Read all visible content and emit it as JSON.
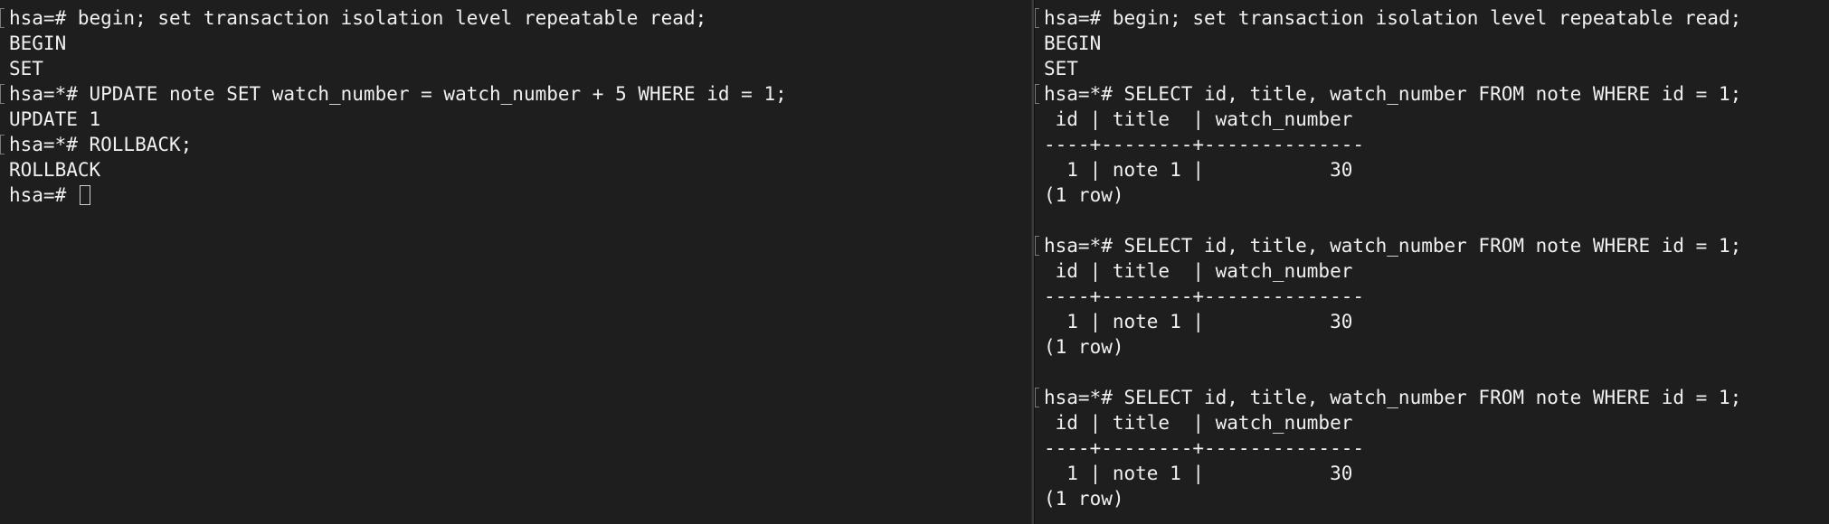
{
  "left_pane": {
    "lines": [
      "hsa=# begin; set transaction isolation level repeatable read;",
      "BEGIN",
      "SET",
      "hsa=*# UPDATE note SET watch_number = watch_number + 5 WHERE id = 1;",
      "UPDATE 1",
      "hsa=*# ROLLBACK;",
      "ROLLBACK",
      "hsa=# "
    ]
  },
  "right_pane": {
    "lines": [
      "hsa=# begin; set transaction isolation level repeatable read;",
      "BEGIN",
      "SET",
      "hsa=*# SELECT id, title, watch_number FROM note WHERE id = 1;",
      " id | title  | watch_number",
      "----+--------+--------------",
      "  1 | note 1 |           30",
      "(1 row)",
      "",
      "hsa=*# SELECT id, title, watch_number FROM note WHERE id = 1;",
      " id | title  | watch_number",
      "----+--------+--------------",
      "  1 | note 1 |           30",
      "(1 row)",
      "",
      "hsa=*# SELECT id, title, watch_number FROM note WHERE id = 1;",
      " id | title  | watch_number",
      "----+--------+--------------",
      "  1 | note 1 |           30",
      "(1 row)"
    ]
  }
}
